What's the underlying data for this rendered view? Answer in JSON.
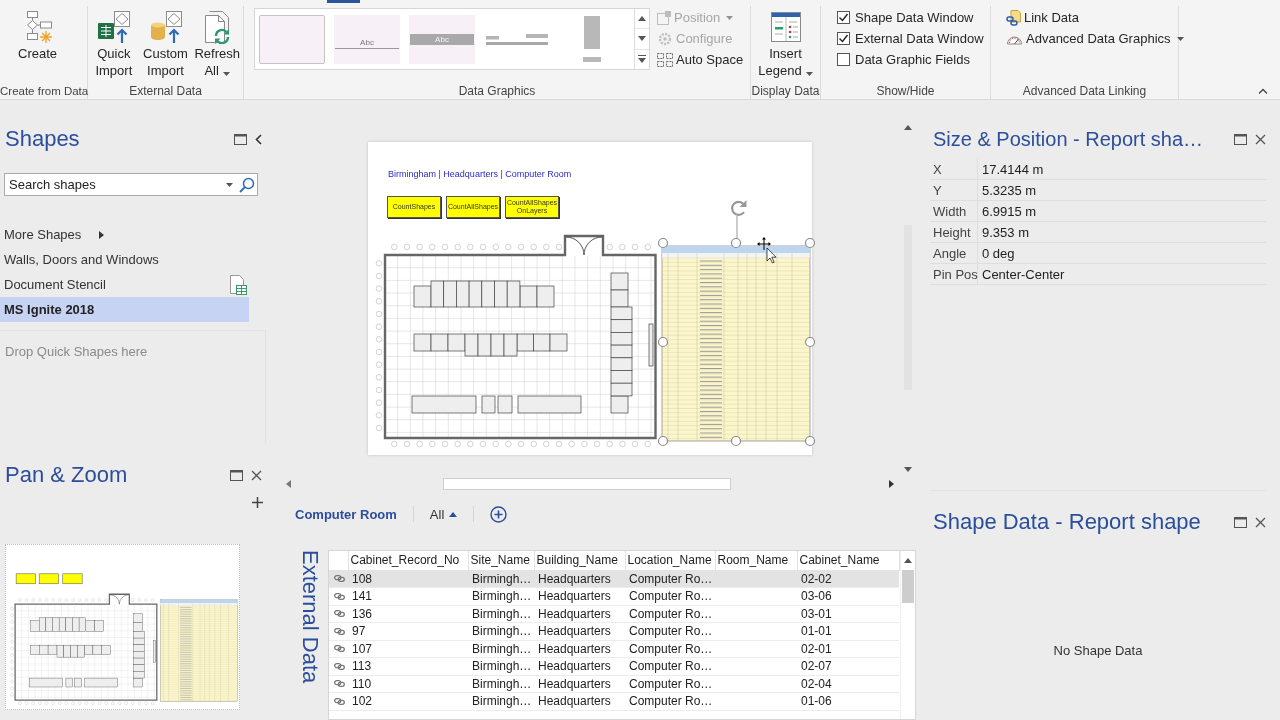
{
  "ribbon": {
    "groups": [
      {
        "label": "Create from Data",
        "buttons": [
          {
            "kind": "create",
            "label": "Create",
            "dropdown": false,
            "disabled": false
          }
        ]
      },
      {
        "label": "External Data",
        "buttons": [
          {
            "kind": "quick_import",
            "label": "Quick Import",
            "dropdown": false,
            "disabled": false
          },
          {
            "kind": "custom_import",
            "label": "Custom Import",
            "dropdown": false,
            "disabled": false
          },
          {
            "kind": "refresh",
            "label": "Refresh All",
            "dropdown": true,
            "disabled": false
          }
        ]
      },
      {
        "label": "Data Graphics",
        "gallery": [
          {
            "kind": "plain",
            "selected": true
          },
          {
            "kind": "underline",
            "text": "Abc",
            "selected": false
          },
          {
            "kind": "banner",
            "text": "Abc",
            "selected": false
          },
          {
            "kind": "bars",
            "selected": false
          },
          {
            "kind": "column",
            "selected": false
          }
        ],
        "buttons": [
          {
            "kind": "position",
            "label": "Position",
            "dropdown": true,
            "disabled": true
          },
          {
            "kind": "configure",
            "label": "Configure",
            "dropdown": false,
            "disabled": true
          },
          {
            "kind": "auto_space",
            "label": "Auto Space",
            "dropdown": false,
            "disabled": false
          }
        ]
      },
      {
        "label": "Display Data",
        "buttons": [
          {
            "kind": "legend",
            "label": "Insert Legend",
            "dropdown": true,
            "disabled": false
          }
        ]
      },
      {
        "label": "Show/Hide",
        "checkboxes": [
          {
            "label": "Shape Data Window",
            "checked": true
          },
          {
            "label": "External Data Window",
            "checked": true
          },
          {
            "label": "Data Graphic Fields",
            "checked": false
          }
        ]
      },
      {
        "label": "Advanced Data Linking",
        "buttons": [
          {
            "kind": "link_data",
            "label": "Link Data",
            "dropdown": false,
            "disabled": false
          },
          {
            "kind": "advanced_graphics",
            "label": "Advanced Data Graphics",
            "dropdown": true,
            "disabled": false
          }
        ]
      }
    ]
  },
  "shapes": {
    "title": "Shapes",
    "search": {
      "placeholder": "Search shapes"
    },
    "more_shapes": "More Shapes",
    "stencils": [
      {
        "label": "Walls, Doors and Windows",
        "kind": "stencil",
        "selected": false
      },
      {
        "label": "Document Stencil",
        "kind": "document",
        "selected": false
      },
      {
        "label": "MS Ignite 2018",
        "kind": "stencil",
        "selected": true
      }
    ],
    "drop_hint": "Drop Quick Shapes here"
  },
  "pan_zoom": {
    "title": "Pan & Zoom"
  },
  "canvas": {
    "title": "Birmingham | Headquarters | Computer Room",
    "command_shapes": [
      "CountShapes",
      "CountAllShapes",
      "CountAllShapes OnLayers"
    ],
    "report": {
      "selected": true
    }
  },
  "external_data": {
    "title": "External Data",
    "tabs": [
      {
        "label": "Computer Room",
        "selected": true
      }
    ],
    "filter": "All",
    "columns": [
      "Cabinet_Record_No",
      "Site_Name",
      "Building_Name",
      "Location_Name",
      "Room_Name",
      "Cabinet_Name"
    ],
    "rows": [
      {
        "selected": true,
        "cabinet_record_no": "108",
        "site_name": "Birmingh…",
        "building_name": "Headquarters",
        "location_name": "Computer Ro…",
        "cabinet_name": "02-02"
      },
      {
        "selected": false,
        "cabinet_record_no": "141",
        "site_name": "Birmingh…",
        "building_name": "Headquarters",
        "location_name": "Computer Ro…",
        "cabinet_name": "03-06"
      },
      {
        "selected": false,
        "cabinet_record_no": "136",
        "site_name": "Birmingh…",
        "building_name": "Headquarters",
        "location_name": "Computer Ro…",
        "cabinet_name": "03-01"
      },
      {
        "selected": false,
        "cabinet_record_no": "97",
        "site_name": "Birmingh…",
        "building_name": "Headquarters",
        "location_name": "Computer Ro…",
        "cabinet_name": "01-01"
      },
      {
        "selected": false,
        "cabinet_record_no": "107",
        "site_name": "Birmingh…",
        "building_name": "Headquarters",
        "location_name": "Computer Ro…",
        "cabinet_name": "02-01"
      },
      {
        "selected": false,
        "cabinet_record_no": "113",
        "site_name": "Birmingh…",
        "building_name": "Headquarters",
        "location_name": "Computer Ro…",
        "cabinet_name": "02-07"
      },
      {
        "selected": false,
        "cabinet_record_no": "110",
        "site_name": "Birmingh…",
        "building_name": "Headquarters",
        "location_name": "Computer Ro…",
        "cabinet_name": "02-04"
      },
      {
        "selected": false,
        "cabinet_record_no": "102",
        "site_name": "Birmingh…",
        "building_name": "Headquarters",
        "location_name": "Computer Ro…",
        "cabinet_name": "01-06"
      }
    ]
  },
  "size_position": {
    "title": "Size & Position - Report sha…",
    "properties": [
      {
        "label": "X",
        "value": "17.4144 m"
      },
      {
        "label": "Y",
        "value": "5.3235 m"
      },
      {
        "label": "Width",
        "value": "6.9915 m"
      },
      {
        "label": "Height",
        "value": "9.353 m"
      },
      {
        "label": "Angle",
        "value": "0 deg"
      },
      {
        "label": "Pin Pos",
        "value": "Center-Center"
      }
    ]
  },
  "shape_data": {
    "title": "Shape Data - Report shape",
    "empty_message": "No Shape Data"
  }
}
